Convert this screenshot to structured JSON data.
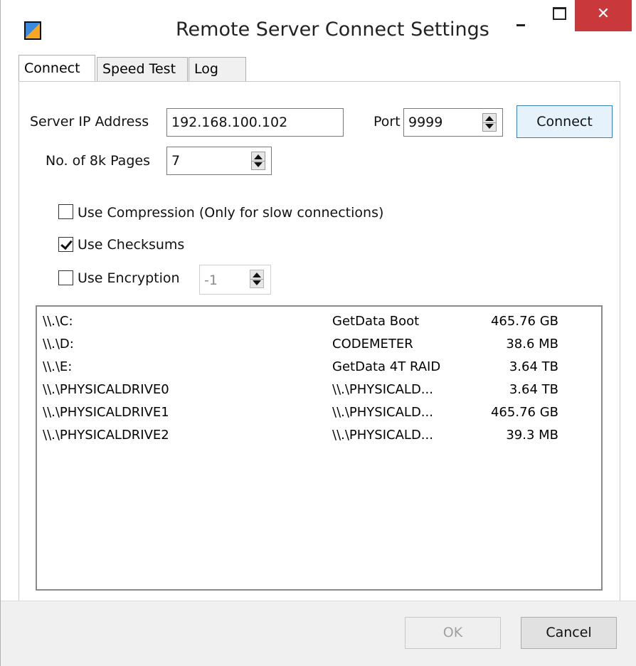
{
  "window": {
    "title": "Remote Server Connect Settings",
    "app_icon": "app-icon",
    "close_glyph": "✕"
  },
  "tabs": [
    {
      "label": "Connect",
      "active": true
    },
    {
      "label": "Speed Test",
      "active": false
    },
    {
      "label": "Log",
      "active": false
    }
  ],
  "connect": {
    "server_ip_label": "Server IP Address",
    "server_ip_value": "192.168.100.102",
    "port_label": "Port",
    "port_value": "9999",
    "connect_button": "Connect",
    "pages_label": "No. of 8k Pages",
    "pages_value": "7",
    "use_compression_label": "Use Compression (Only for slow connections)",
    "use_compression_checked": false,
    "use_checksums_label": "Use Checksums",
    "use_checksums_checked": true,
    "use_encryption_label": "Use Encryption",
    "use_encryption_checked": false,
    "encryption_value": "-1"
  },
  "drives": [
    {
      "path": "\\\\.\\C:",
      "name": "GetData Boot",
      "size": "465.76 GB"
    },
    {
      "path": "\\\\.\\D:",
      "name": "CODEMETER",
      "size": "38.6 MB"
    },
    {
      "path": "\\\\.\\E:",
      "name": "GetData 4T RAID",
      "size": "3.64 TB"
    },
    {
      "path": "\\\\.\\PHYSICALDRIVE0",
      "name": "\\\\.\\PHYSICALD...",
      "size": "3.64 TB"
    },
    {
      "path": "\\\\.\\PHYSICALDRIVE1",
      "name": "\\\\.\\PHYSICALD...",
      "size": "465.76 GB"
    },
    {
      "path": "\\\\.\\PHYSICALDRIVE2",
      "name": "\\\\.\\PHYSICALD...",
      "size": "39.3 MB"
    }
  ],
  "footer": {
    "ok_label": "OK",
    "cancel_label": "Cancel"
  },
  "colors": {
    "close_button": "#c9383a",
    "primary_button_border": "#3c7fb1",
    "primary_button_bg": "#e5f1fb"
  }
}
